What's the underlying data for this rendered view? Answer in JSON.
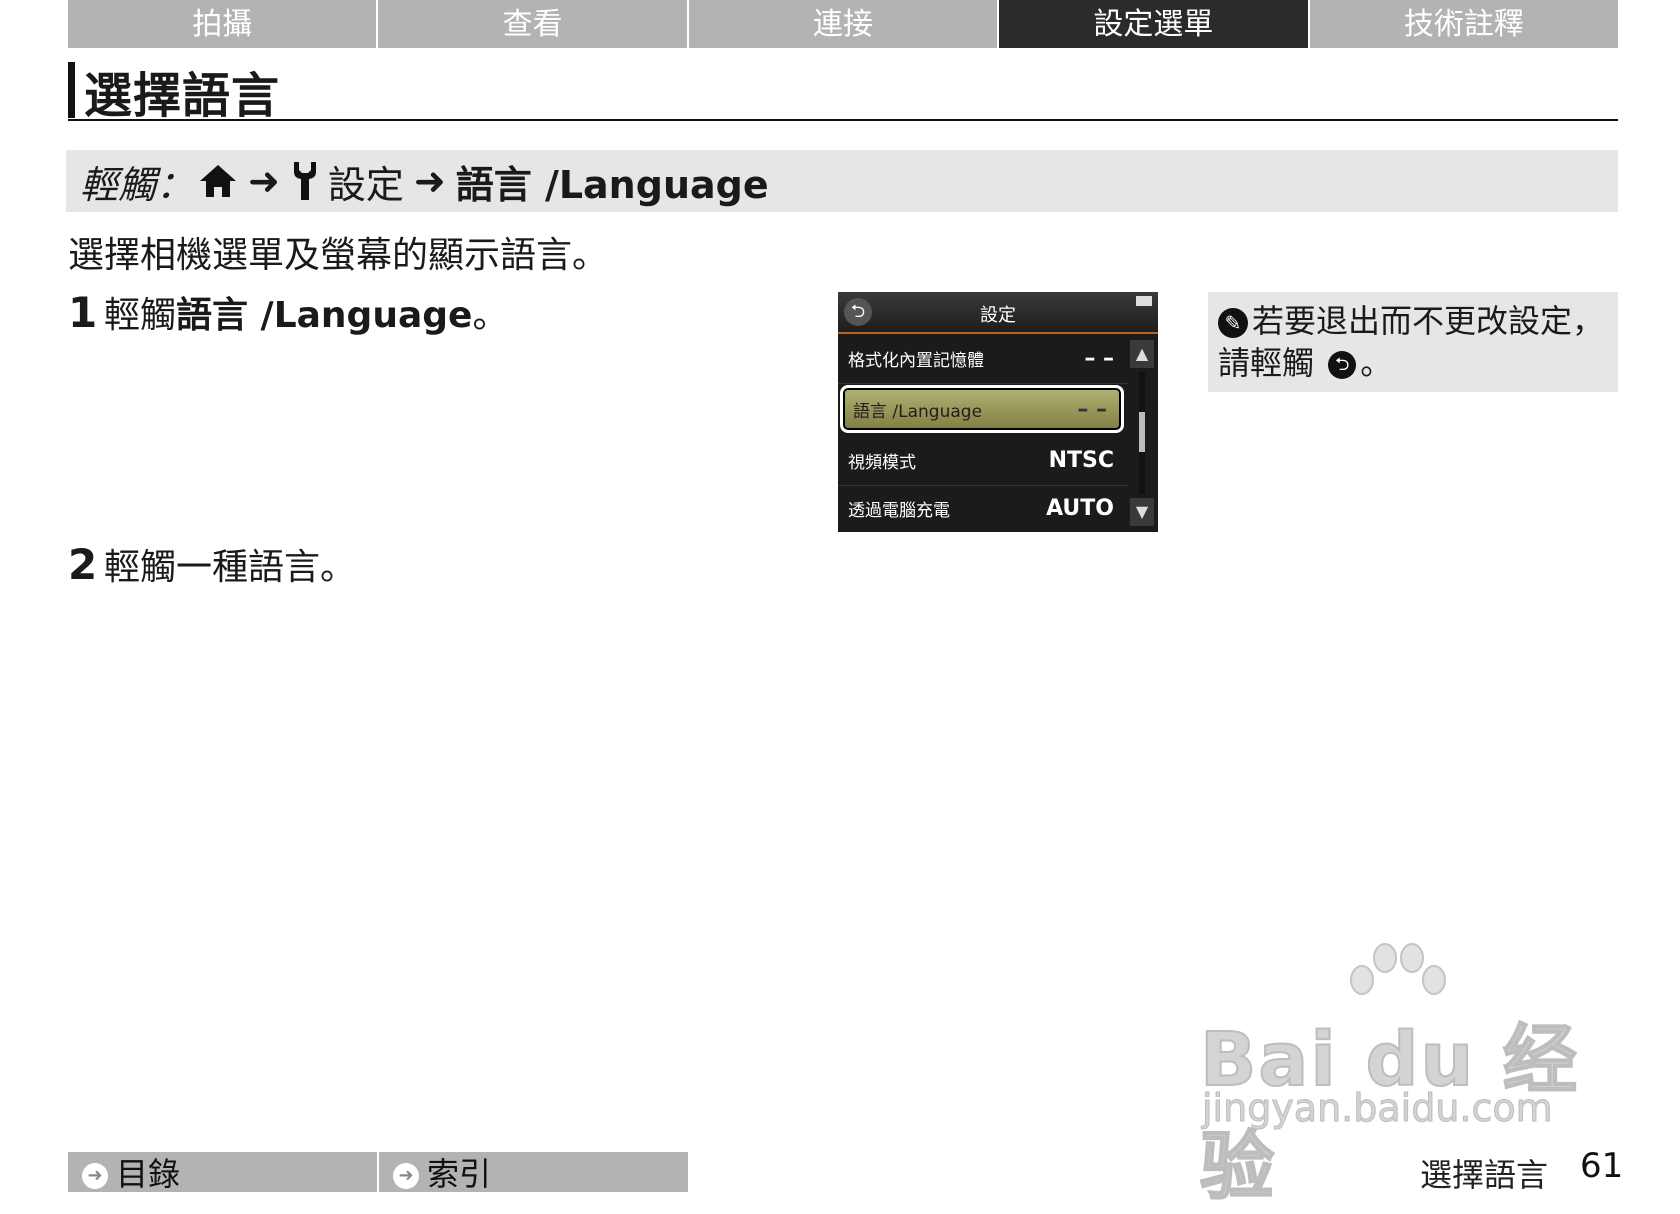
{
  "tabs": [
    {
      "label": "拍攝",
      "active": false
    },
    {
      "label": "查看",
      "active": false
    },
    {
      "label": "連接",
      "active": false
    },
    {
      "label": "設定選單",
      "active": true
    },
    {
      "label": "技術註釋",
      "active": false
    }
  ],
  "page_title": "選擇語言",
  "path": {
    "touch_label": "輕觸：",
    "home_icon": "home-icon",
    "arrow": "➜",
    "setup_icon": "wrench-icon",
    "setup_label": "設定",
    "language_label": "語言 /Language"
  },
  "description": "選擇相機選單及螢幕的顯示語言。",
  "steps": [
    {
      "num": "1",
      "text_pre": "輕觸 ",
      "text_bold": "語言 /Language",
      "text_post": "。"
    },
    {
      "num": "2",
      "text_pre": "輕觸一種語言",
      "text_bold": "",
      "text_post": "。"
    }
  ],
  "screen": {
    "title": "設定",
    "back_icon": "back-icon",
    "rows": [
      {
        "label": "格式化內置記憶體",
        "value": "– –",
        "selected": false
      },
      {
        "label": "語言 /Language",
        "value": "– –",
        "selected": true
      },
      {
        "label": "視頻模式",
        "value": "NTSC",
        "selected": false
      },
      {
        "label": "透過電腦充電",
        "value": "AUTO",
        "selected": false
      }
    ],
    "scroll_up": "▲",
    "scroll_down": "▼"
  },
  "note": {
    "icon": "pencil-icon",
    "line1": "若要退出而不更改設定，",
    "line2_pre": "請輕觸",
    "back_icon": "back-icon",
    "line2_post": "。"
  },
  "watermark": {
    "main": "Bai du 经验",
    "sub": "jingyan.baidu.com"
  },
  "footer": {
    "links": [
      {
        "label": "目錄",
        "icon": "arrow-right-circle-icon"
      },
      {
        "label": "索引",
        "icon": "arrow-right-circle-icon"
      }
    ],
    "page_label": "選擇語言",
    "page_number": "61"
  }
}
